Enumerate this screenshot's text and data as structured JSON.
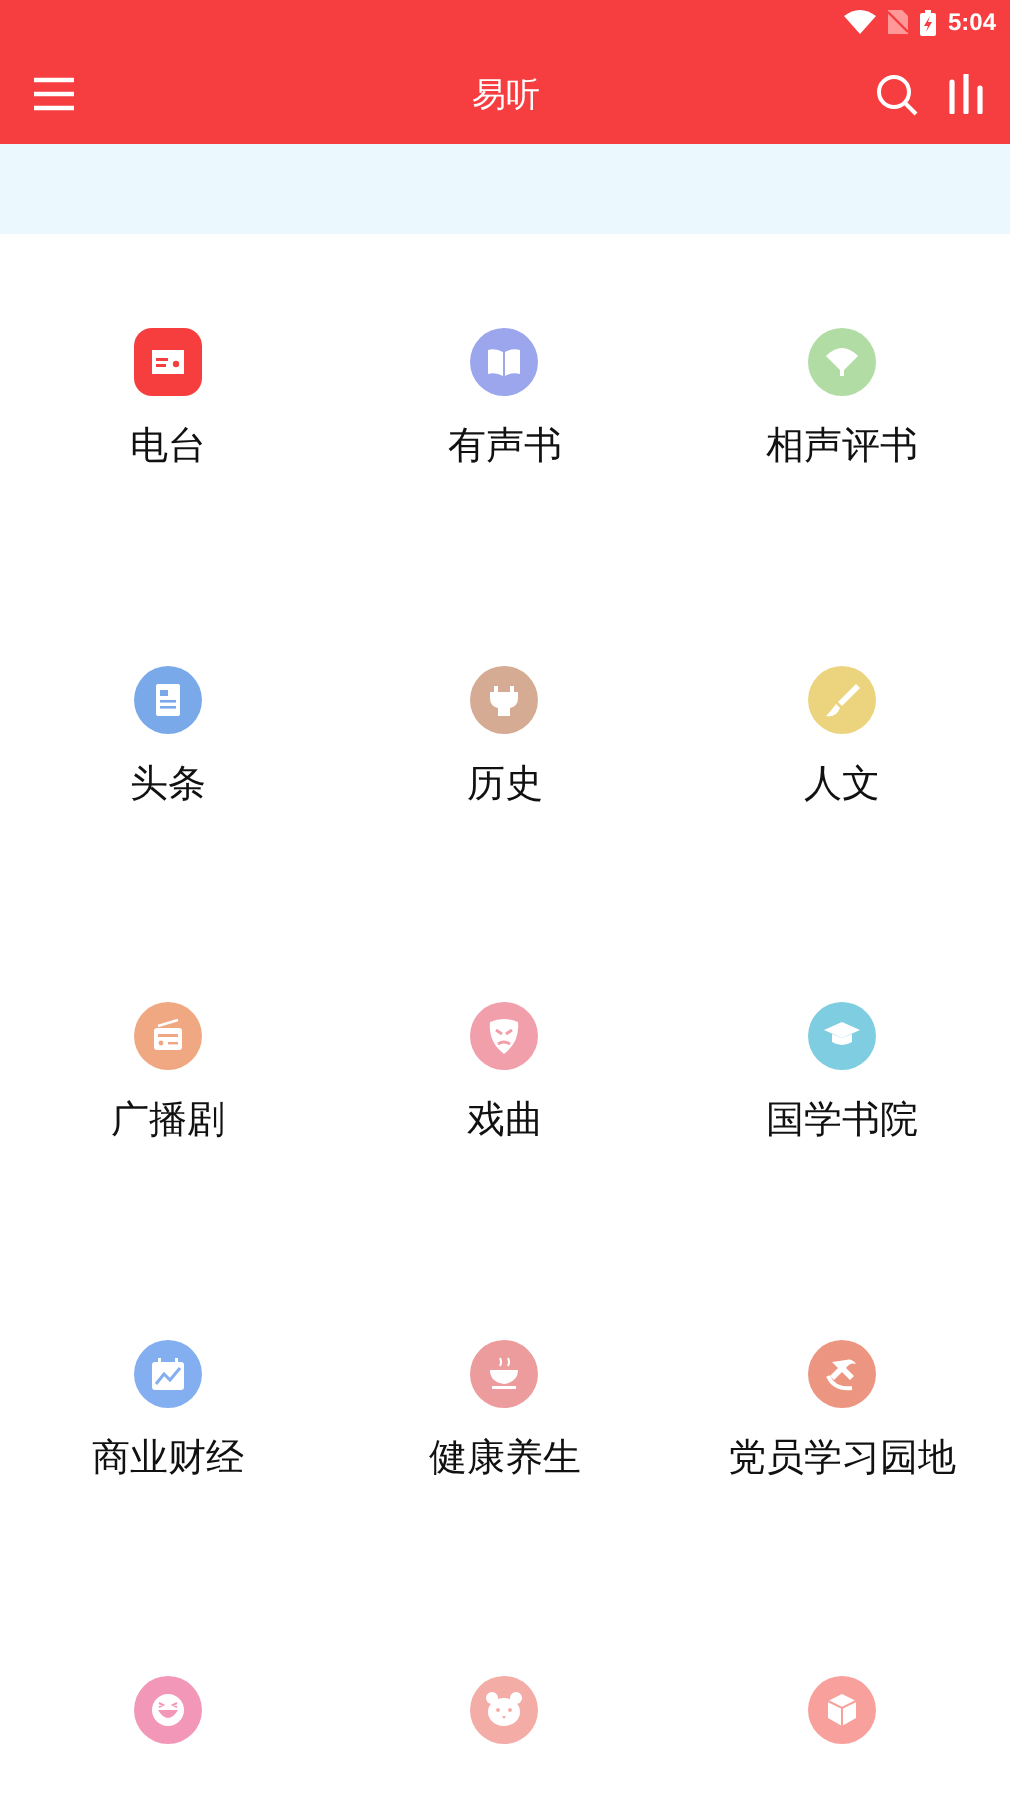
{
  "status_bar": {
    "time": "5:04"
  },
  "toolbar": {
    "title": "易听"
  },
  "categories": [
    {
      "label": "电台",
      "color": "#f73e3f"
    },
    {
      "label": "有声书",
      "color": "#9ba6ec"
    },
    {
      "label": "相声评书",
      "color": "#b1dca4"
    },
    {
      "label": "头条",
      "color": "#7aa9ea"
    },
    {
      "label": "历史",
      "color": "#d6ab93"
    },
    {
      "label": "人文",
      "color": "#ecd47f"
    },
    {
      "label": "广播剧",
      "color": "#f0a882"
    },
    {
      "label": "戏曲",
      "color": "#f09fab"
    },
    {
      "label": "国学书院",
      "color": "#7fcde0"
    },
    {
      "label": "商业财经",
      "color": "#83aff0"
    },
    {
      "label": "健康养生",
      "color": "#ec9c9c"
    },
    {
      "label": "党员学习园地",
      "color": "#ec9580"
    },
    {
      "color": "#f297b8"
    },
    {
      "color": "#f4aca6"
    },
    {
      "color": "#f8a09c"
    }
  ]
}
